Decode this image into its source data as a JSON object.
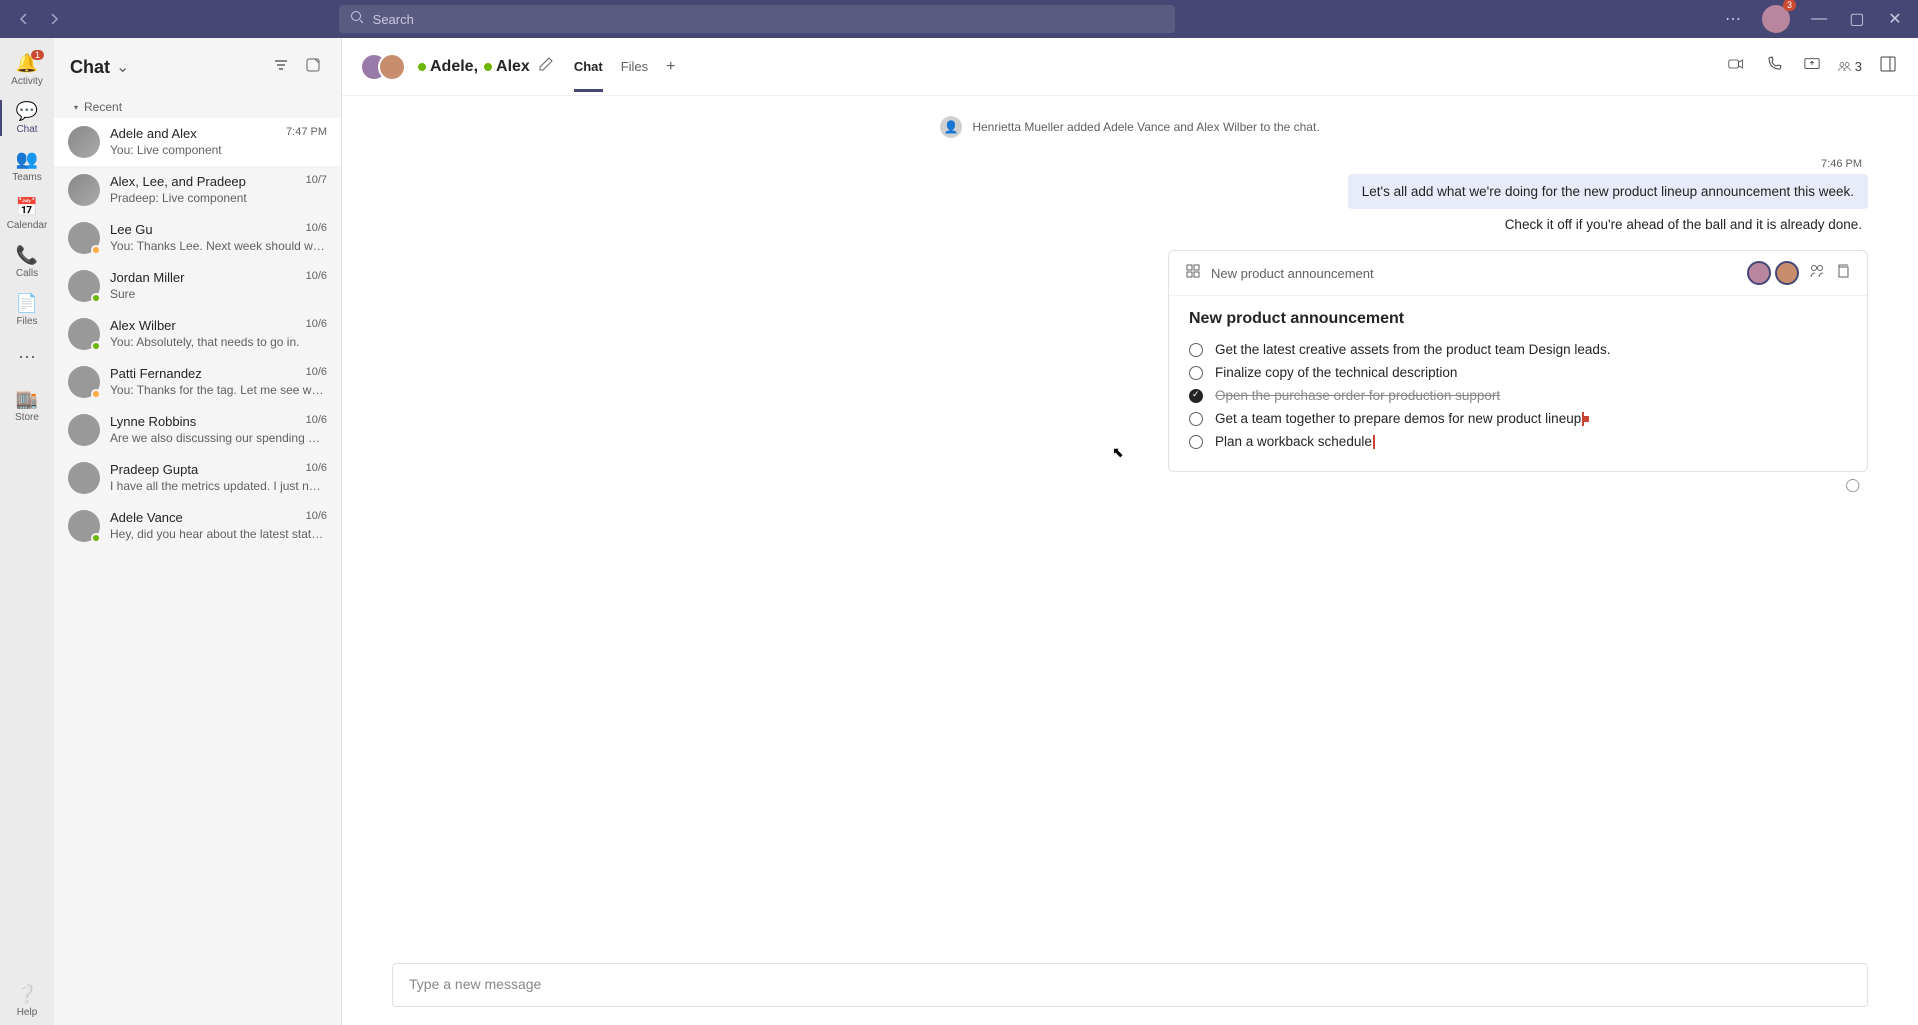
{
  "search": {
    "placeholder": "Search"
  },
  "profile_badge": "3",
  "rail": {
    "activity": {
      "label": "Activity",
      "badge": "1"
    },
    "chat": {
      "label": "Chat"
    },
    "teams": {
      "label": "Teams"
    },
    "calendar": {
      "label": "Calendar"
    },
    "calls": {
      "label": "Calls"
    },
    "files": {
      "label": "Files"
    },
    "store": {
      "label": "Store"
    },
    "help": {
      "label": "Help"
    }
  },
  "chatlist": {
    "title": "Chat",
    "recent_label": "Recent",
    "items": [
      {
        "name": "Adele and Alex",
        "time": "7:47 PM",
        "preview": "You: Live component"
      },
      {
        "name": "Alex, Lee, and Pradeep",
        "time": "10/7",
        "preview": "Pradeep: Live component"
      },
      {
        "name": "Lee Gu",
        "time": "10/6",
        "preview": "You: Thanks Lee. Next week should work. Let's br..."
      },
      {
        "name": "Jordan Miller",
        "time": "10/6",
        "preview": "Sure"
      },
      {
        "name": "Alex Wilber",
        "time": "10/6",
        "preview": "You: Absolutely, that needs to go in."
      },
      {
        "name": "Patti Fernandez",
        "time": "10/6",
        "preview": "You: Thanks for the tag. Let me see what I can co..."
      },
      {
        "name": "Lynne Robbins",
        "time": "10/6",
        "preview": "Are we also discussing our spending metrics?"
      },
      {
        "name": "Pradeep Gupta",
        "time": "10/6",
        "preview": "I have all the metrics updated. I just need the tea..."
      },
      {
        "name": "Adele Vance",
        "time": "10/6",
        "preview": "Hey, did you hear about the latest status?"
      }
    ]
  },
  "header": {
    "name1": "Adele,",
    "name2": "Alex",
    "tabs": {
      "chat": "Chat",
      "files": "Files"
    },
    "participants": "3"
  },
  "system_message": "Henrietta Mueller added Adele Vance and Alex Wilber to the chat.",
  "messages": {
    "m1_time": "7:46 PM",
    "m1_text": "Let's all add what we're doing for the new product lineup announcement this week.",
    "m2_text": "Check it off if you're ahead of the ball and it is already done."
  },
  "loop": {
    "breadcrumb": "New product announcement",
    "title": "New product announcement",
    "items": [
      {
        "text": "Get the latest creative assets from the product team Design leads.",
        "done": false
      },
      {
        "text": "Finalize copy of the technical description",
        "done": false
      },
      {
        "text": "Open the purchase order for production support",
        "done": true
      },
      {
        "text": "Get a team together to prepare demos for new product lineup",
        "done": false,
        "cursor": true
      },
      {
        "text": "Plan a workback schedule",
        "done": false,
        "cursor": true
      }
    ]
  },
  "compose": {
    "placeholder": "Type a new message"
  }
}
